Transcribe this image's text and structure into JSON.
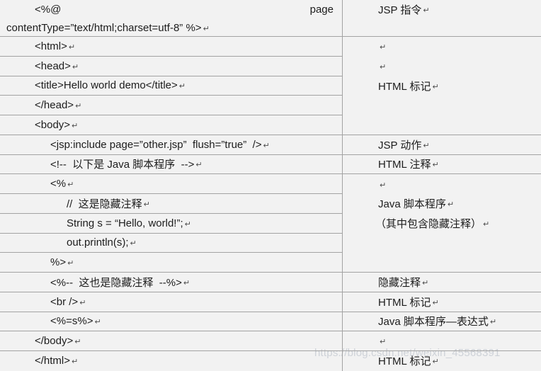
{
  "marks": {
    "pilcrow": "↵"
  },
  "watermark": {
    "text": "https://blog.csdn.net/weixin_45568391"
  },
  "left": {
    "r1a": "<%@",
    "r1b": "page",
    "r1line2": "contentType=”text/html;charset=utf-8” %>",
    "rows": [
      "<html>",
      "<head>",
      "<title>Hello world demo</title>",
      "</head>",
      "<body>",
      "<jsp:include page=”other.jsp”  flush=”true”  />",
      "<!--  以下是 Java 脚本程序  -->",
      "<%",
      "//  这是隐藏注释",
      "String s = “Hello, world!”;",
      "out.println(s);",
      "%>",
      "<%--  这也是隐藏注释  --%>",
      "<br />",
      "<%=s%>",
      "</body>",
      "</html>"
    ]
  },
  "right": {
    "jsp_directive": "JSP 指令",
    "html_tag_1": "HTML 标记",
    "jsp_action": "JSP 动作",
    "html_comment": "HTML 注释",
    "java_script_1": "Java 脚本程序",
    "java_script_2": "（其中包含隐藏注释）",
    "hidden_comment": "隐藏注释",
    "html_tag_2": "HTML 标记",
    "java_expression": "Java 脚本程序—表达式",
    "html_tag_3": "HTML 标记"
  }
}
